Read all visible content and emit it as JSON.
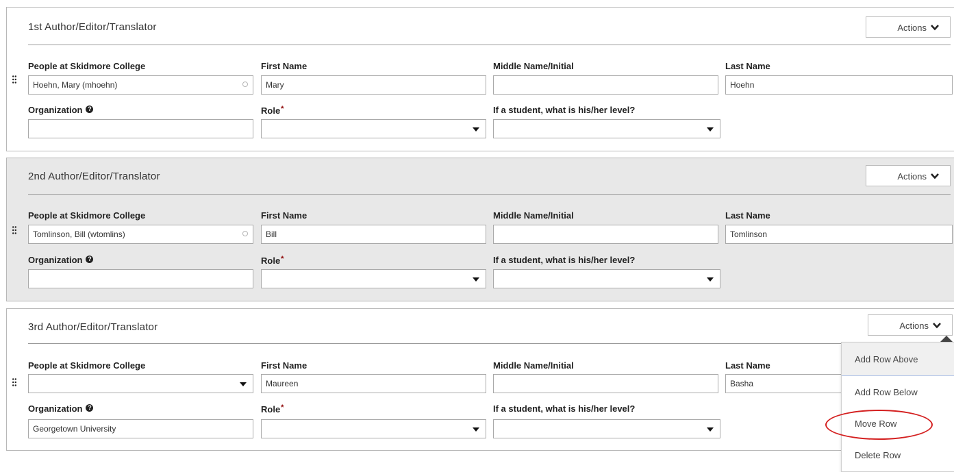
{
  "common": {
    "actions_label": "Actions",
    "people_label": "People at Skidmore College",
    "first_name_label": "First Name",
    "middle_name_label": "Middle Name/Initial",
    "last_name_label": "Last Name",
    "organization_label": "Organization",
    "role_label": "Role",
    "required_marker": "*",
    "help_glyph": "?",
    "student_level_label": "If a student, what is his/her level?"
  },
  "authors": [
    {
      "title": "1st Author/Editor/Translator",
      "person": "Hoehn, Mary (mhoehn)",
      "first_name": "Mary",
      "middle_name": "",
      "last_name": "Hoehn",
      "organization": "",
      "role": "",
      "student_level": ""
    },
    {
      "title": "2nd Author/Editor/Translator",
      "person": "Tomlinson, Bill (wtomlins)",
      "first_name": "Bill",
      "middle_name": "",
      "last_name": "Tomlinson",
      "organization": "",
      "role": "",
      "student_level": ""
    },
    {
      "title": "3rd Author/Editor/Translator",
      "person": "",
      "first_name": "Maureen",
      "middle_name": "",
      "last_name": "Basha",
      "organization": "Georgetown University",
      "role": "",
      "student_level": ""
    }
  ],
  "actions_menu": {
    "items": [
      "Add Row Above",
      "Add Row Below",
      "Move Row",
      "Delete Row"
    ],
    "highlighted": "Add Row Above",
    "circled": "Move Row"
  },
  "colors": {
    "required": "#8b0000",
    "annotation_circle": "#d42020",
    "grey_panel": "#e8e8e8"
  }
}
